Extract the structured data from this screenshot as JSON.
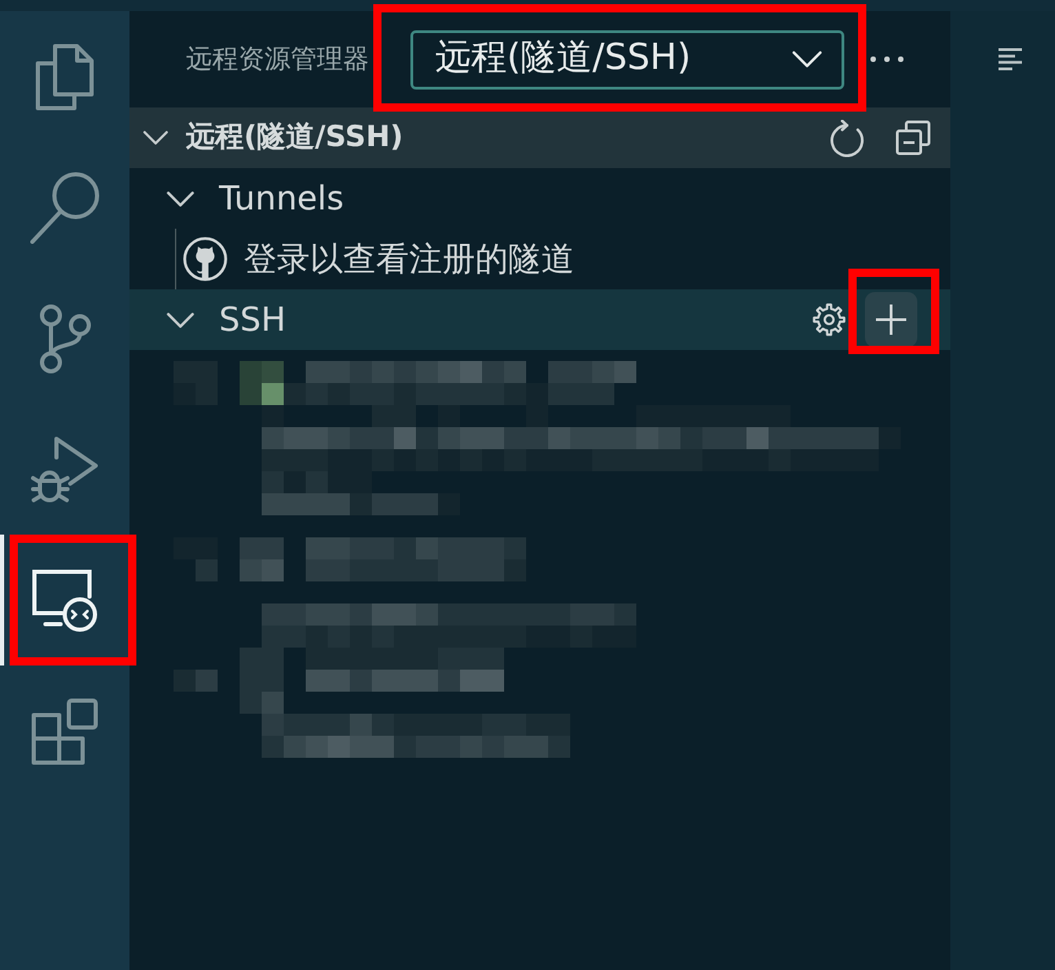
{
  "activity_bar": [
    {
      "kind": "explorer",
      "selected": false
    },
    {
      "kind": "search",
      "selected": false
    },
    {
      "kind": "source_control",
      "selected": false
    },
    {
      "kind": "run_debug",
      "selected": false
    },
    {
      "kind": "remote_explorer",
      "selected": true,
      "highlighted": true
    },
    {
      "kind": "extensions",
      "selected": false
    }
  ],
  "sidebar": {
    "title": "远程资源管理器",
    "view_selector": {
      "value": "远程(隧道/SSH)",
      "highlighted": true
    }
  },
  "section": {
    "title": "远程(隧道/SSH)",
    "expanded": true,
    "actions": [
      {
        "kind": "refresh"
      },
      {
        "kind": "collapse_all"
      }
    ]
  },
  "tree": [
    {
      "label": "Tunnels",
      "expanded": true,
      "selected": false,
      "children": [
        {
          "label": "登录以查看注册的隧道",
          "kind": "sign_in"
        }
      ]
    },
    {
      "label": "SSH",
      "expanded": true,
      "selected": true,
      "actions": [
        {
          "kind": "settings"
        },
        {
          "kind": "add",
          "highlighted": true
        }
      ]
    }
  ]
}
